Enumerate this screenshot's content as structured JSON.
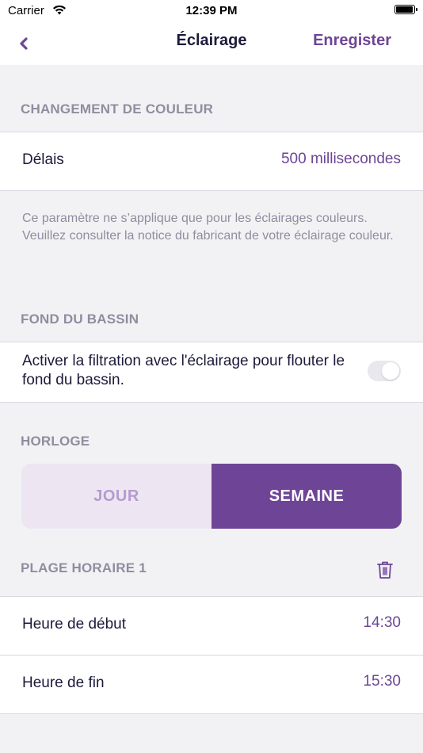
{
  "status_bar": {
    "carrier": "Carrier",
    "time": "12:39 PM",
    "icons": [
      "wifi-icon",
      "battery-icon"
    ]
  },
  "nav": {
    "back_icon": "chevron-left-icon",
    "title": "Éclairage",
    "save_label": "Enregister"
  },
  "color_change": {
    "header": "CHANGEMENT DE COULEUR",
    "delay_label": "Délais",
    "delay_value": "500 millisecondes",
    "note": "Ce paramètre ne s’applique que pour les éclairages couleurs. Veuillez consulter la notice du fabricant de votre éclairage couleur."
  },
  "pool_floor": {
    "header": "FOND DU BASSIN",
    "toggle_label": "Activer la filtration avec l'éclairage pour flouter le fond du bassin.",
    "toggle_on": false
  },
  "clock": {
    "header": "HORLOGE",
    "segments": [
      "JOUR",
      "SEMAINE"
    ],
    "selected": "SEMAINE"
  },
  "time_slot": {
    "header": "PLAGE HORAIRE 1",
    "delete_icon": "trash-icon",
    "start_label": "Heure de début",
    "start_value": "14:30",
    "end_label": "Heure de fin",
    "end_value": "15:30"
  },
  "colors": {
    "accent": "#6e4596",
    "accent_light": "#ede6f2",
    "text_primary": "#1c1a3a",
    "text_secondary": "#8f8d9f",
    "background": "#f2f2f4"
  }
}
